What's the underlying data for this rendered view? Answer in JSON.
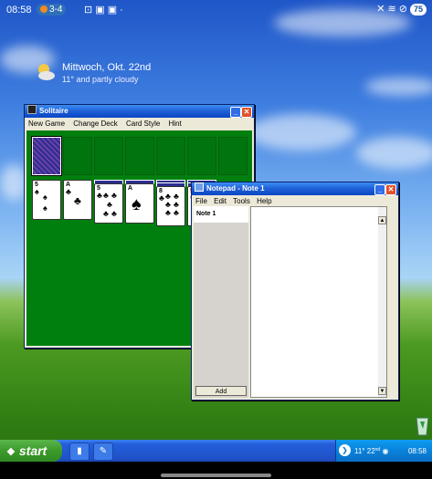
{
  "status_bar": {
    "time": "08:58",
    "pill_text": "3-4",
    "battery": "75"
  },
  "weather_widget": {
    "date": "Mittwoch, Okt. 22nd",
    "condition": "11° and partly cloudy"
  },
  "solitaire": {
    "title": "Solitaire",
    "menu": [
      "New Game",
      "Change Deck",
      "Card Style",
      "Hint"
    ],
    "cards": [
      {
        "rank": "5",
        "suit": "♠"
      },
      {
        "rank": "A",
        "suit": "♣"
      },
      {
        "rank": "5",
        "suit": "♣"
      },
      {
        "rank": "A",
        "suit": "♠"
      },
      {
        "rank": "8",
        "suit": "♣"
      },
      {
        "rank": "5",
        "suit": "♥"
      }
    ]
  },
  "notepad": {
    "title": "Notepad - Note 1",
    "menu": [
      "File",
      "Edit",
      "Tools",
      "Help"
    ],
    "note_name": "Note 1",
    "add_button": "Add"
  },
  "taskbar": {
    "start_label": "start",
    "temperature": "11°",
    "date_num": "22",
    "date_suffix": "nd",
    "clock": "08:58"
  },
  "colors": {
    "felt": "#007f0e",
    "titlebar": "#0a46c4",
    "taskbar": "#245edb",
    "start": "#3c9a2c",
    "close_button": "#e0512a"
  },
  "icons": [
    "weather-sun-cloud-icon",
    "solitaire-app-icon",
    "notepad-app-icon",
    "windows-flag-icon",
    "tray-arrow-icon",
    "speaker-icon",
    "recycle-bin-icon"
  ]
}
